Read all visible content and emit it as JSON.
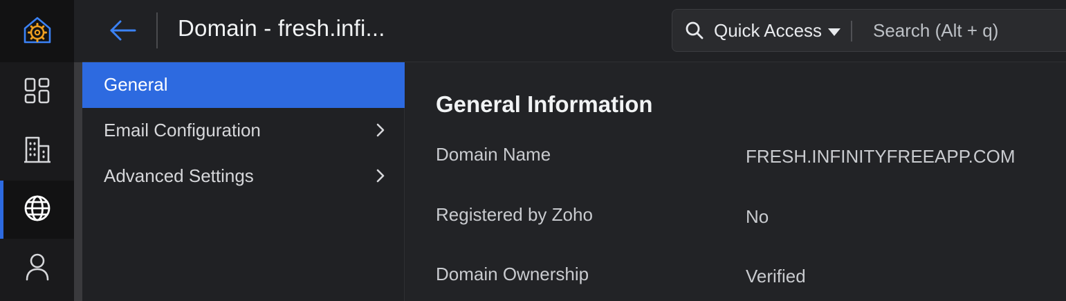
{
  "header": {
    "title": "Domain - fresh.infi...",
    "quick_access_label": "Quick Access",
    "search_placeholder": "Search (Alt + q)"
  },
  "rail": {
    "logo_icon": "admin-gear-home-icon",
    "items": [
      {
        "icon": "dashboard-icon",
        "active": false
      },
      {
        "icon": "organization-building-icon",
        "active": false
      },
      {
        "icon": "globe-icon",
        "active": true
      },
      {
        "icon": "user-icon",
        "active": false
      }
    ]
  },
  "nav": {
    "items": [
      {
        "label": "General",
        "active": true,
        "has_submenu": false
      },
      {
        "label": "Email Configuration",
        "active": false,
        "has_submenu": true
      },
      {
        "label": "Advanced Settings",
        "active": false,
        "has_submenu": true
      }
    ]
  },
  "main": {
    "section_title": "General Information",
    "fields": [
      {
        "label": "Domain Name",
        "value": "FRESH.INFINITYFREEAPP.COM"
      },
      {
        "label": "Registered by Zoho",
        "value": "No"
      },
      {
        "label": "Domain Ownership",
        "value": "Verified"
      }
    ]
  },
  "colors": {
    "accent": "#2d6ae0",
    "background": "#202124",
    "rail_background": "#1a1a1c",
    "logo_orange": "#f0a020",
    "logo_blue": "#3b82f6"
  }
}
